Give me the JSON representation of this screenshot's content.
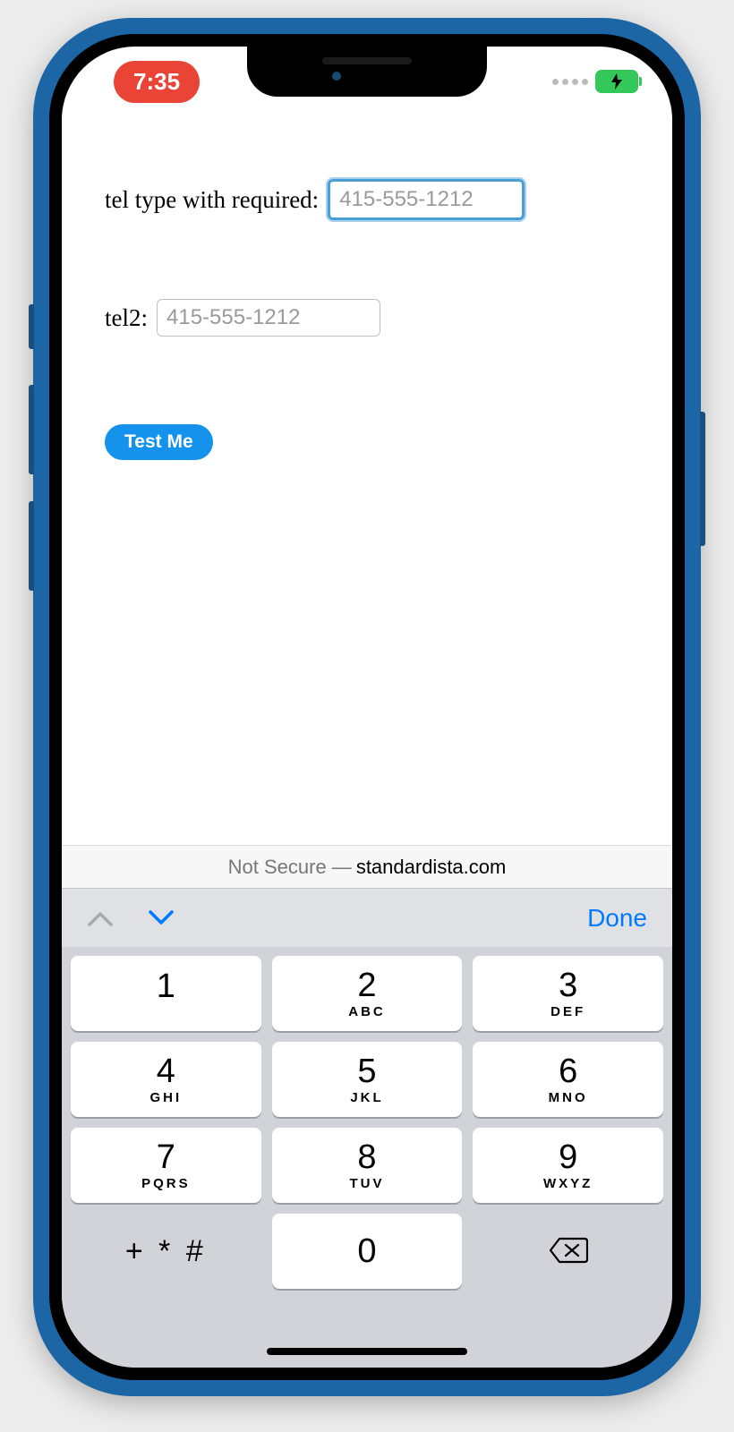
{
  "statusbar": {
    "time": "7:35"
  },
  "content": {
    "field1": {
      "label": "tel type with required:",
      "placeholder": "415-555-1212",
      "value": ""
    },
    "field2": {
      "label": "tel2:",
      "placeholder": "415-555-1212",
      "value": ""
    },
    "button": "Test Me"
  },
  "urlbar": {
    "prefix": "Not Secure —",
    "domain": "standardista.com"
  },
  "keyboard": {
    "done": "Done",
    "keys": [
      {
        "num": "1",
        "sub": ""
      },
      {
        "num": "2",
        "sub": "ABC"
      },
      {
        "num": "3",
        "sub": "DEF"
      },
      {
        "num": "4",
        "sub": "GHI"
      },
      {
        "num": "5",
        "sub": "JKL"
      },
      {
        "num": "6",
        "sub": "MNO"
      },
      {
        "num": "7",
        "sub": "PQRS"
      },
      {
        "num": "8",
        "sub": "TUV"
      },
      {
        "num": "9",
        "sub": "WXYZ"
      }
    ],
    "symbols": "+ * #",
    "zero": "0"
  }
}
